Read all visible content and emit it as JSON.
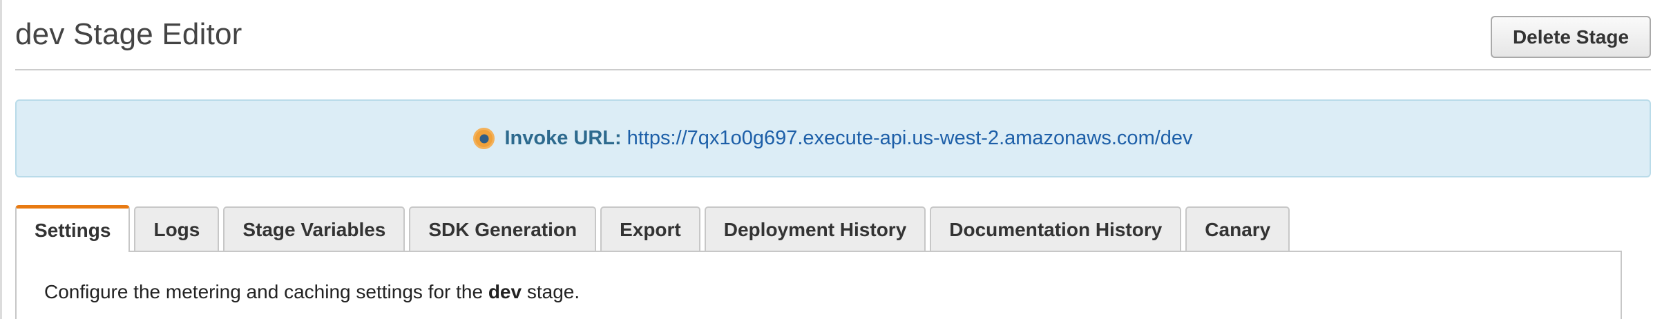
{
  "header": {
    "title": "dev Stage Editor",
    "delete_button": "Delete Stage"
  },
  "invoke": {
    "icon": "invoke-url-icon",
    "label": "Invoke URL:",
    "url": "https://7qx1o0g697.execute-api.us-west-2.amazonaws.com/dev"
  },
  "tabs": [
    {
      "label": "Settings",
      "active": true
    },
    {
      "label": "Logs"
    },
    {
      "label": "Stage Variables"
    },
    {
      "label": "SDK Generation"
    },
    {
      "label": "Export"
    },
    {
      "label": "Deployment History"
    },
    {
      "label": "Documentation History"
    },
    {
      "label": "Canary"
    }
  ],
  "settings": {
    "description_prefix": "Configure the metering and caching settings for the ",
    "stage_name": "dev",
    "description_suffix": " stage."
  },
  "colors": {
    "accent_tab": "#e87a12",
    "info_bg": "#dcedf6",
    "link": "#1d5fa8"
  }
}
